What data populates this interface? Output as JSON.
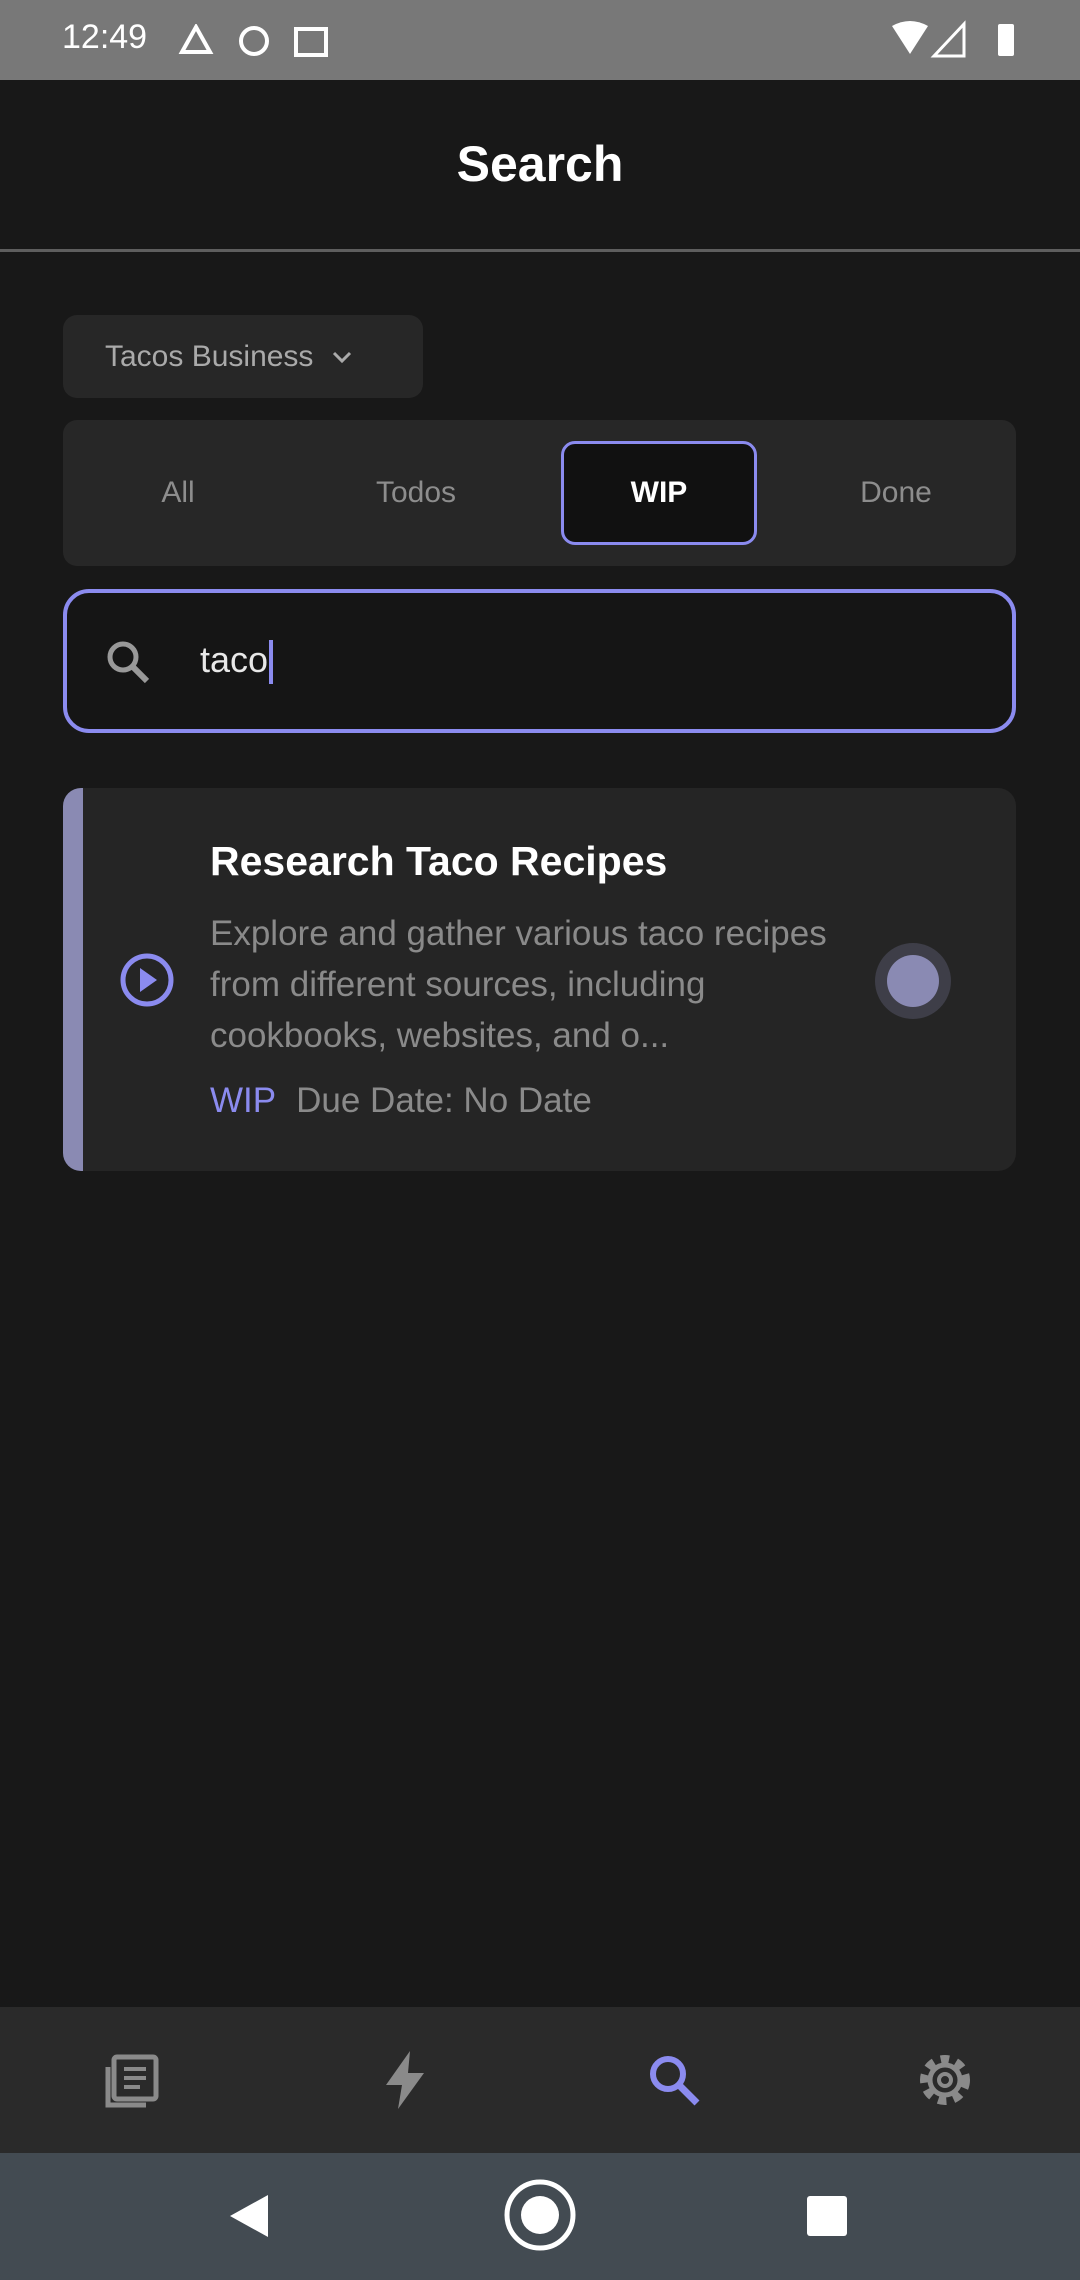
{
  "status_bar": {
    "time": "12:49",
    "icons": [
      "drive-icon",
      "sync-icon",
      "calendar-icon",
      "wifi-icon",
      "signal-icon",
      "battery-charging-icon"
    ]
  },
  "header": {
    "title": "Search"
  },
  "project_selector": {
    "selected": "Tacos Business"
  },
  "filter_tabs": {
    "items": [
      {
        "label": "All"
      },
      {
        "label": "Todos"
      },
      {
        "label": "WIP"
      },
      {
        "label": "Done"
      }
    ],
    "active": "WIP"
  },
  "search": {
    "value": "taco"
  },
  "results": [
    {
      "title": "Research Taco Recipes",
      "description": "Explore and gather various taco recipes from different sources, including cookbooks, websites, and o...",
      "status": "WIP",
      "due": "Due Date: No Date",
      "status_icon": "play-circle-icon"
    }
  ],
  "bottom_nav": {
    "items": [
      "tasks-icon",
      "lightning-icon",
      "search-icon",
      "settings-icon"
    ],
    "active": "search-icon"
  },
  "colors": {
    "accent": "#8b8bef",
    "card_bar": "#8a8ab3",
    "background": "#181818"
  }
}
